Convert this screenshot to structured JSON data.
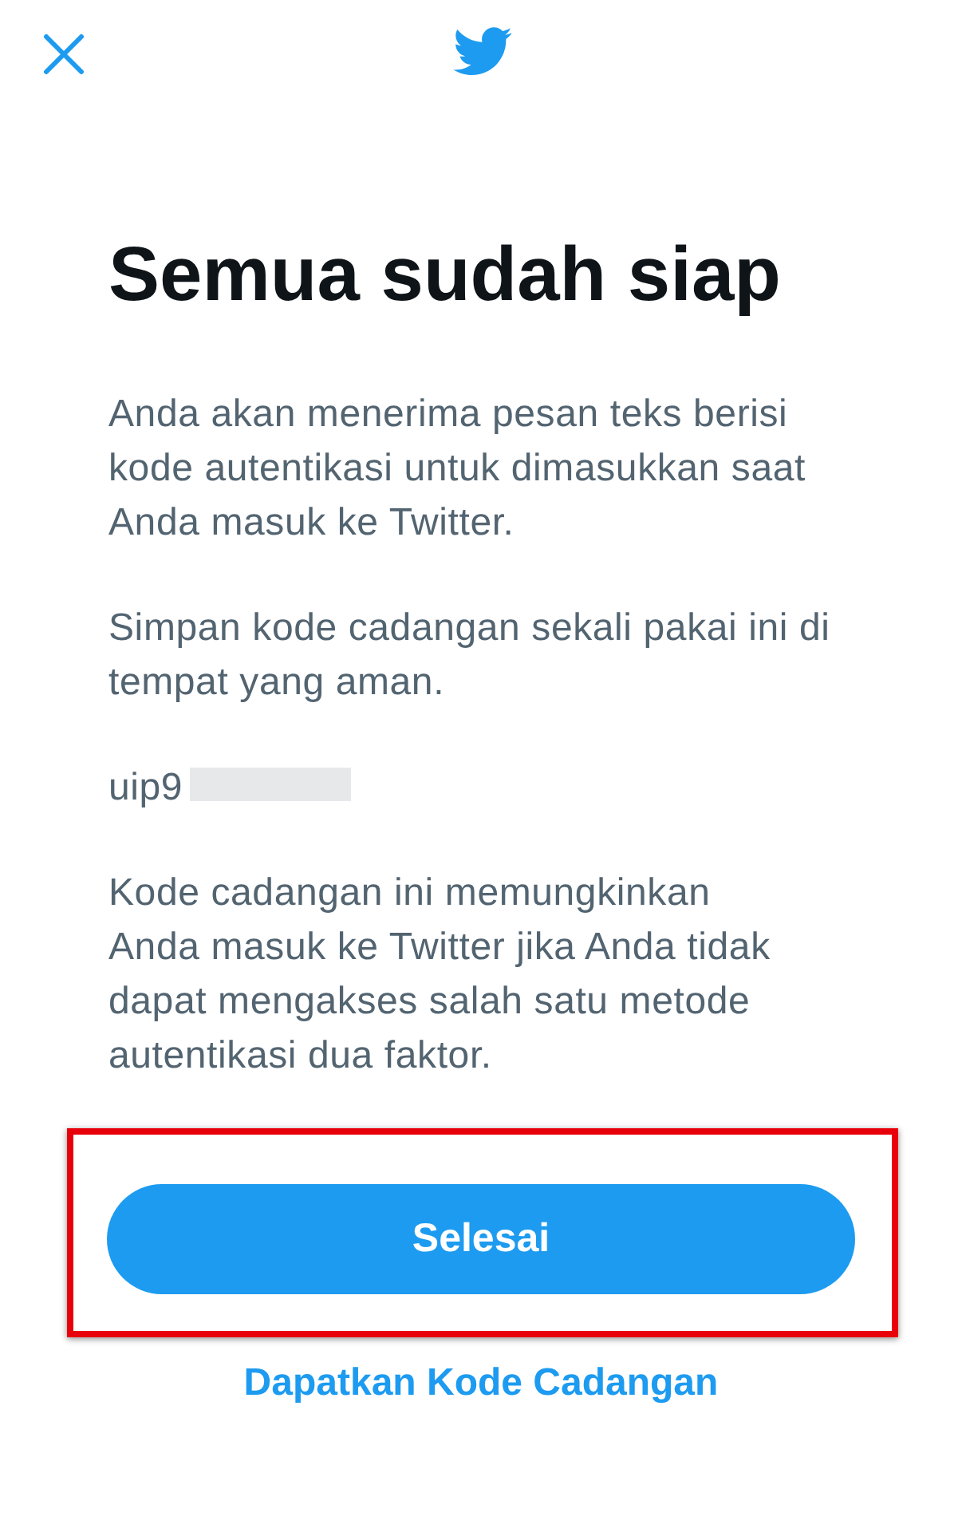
{
  "title": "Semua sudah siap",
  "content": [
    {
      "kind": "paragraph",
      "text": "Anda akan menerima pesan teks berisi kode autentikasi untuk dimasukkan saat Anda masuk ke Twitter."
    },
    {
      "kind": "paragraph",
      "text": "Simpan kode cadangan sekali pakai ini di tempat yang aman."
    },
    {
      "kind": "code",
      "text": "uip9",
      "redacted": true
    },
    {
      "kind": "paragraph",
      "text": "Kode cadangan ini memungkinkan\nAnda masuk ke Twitter jika Anda tidak dapat mengakses salah satu metode autentikasi dua faktor."
    }
  ],
  "done_button": {
    "label": "Selesai",
    "highlighted": true
  },
  "link": {
    "label": "Dapatkan Kode Cadangan"
  }
}
